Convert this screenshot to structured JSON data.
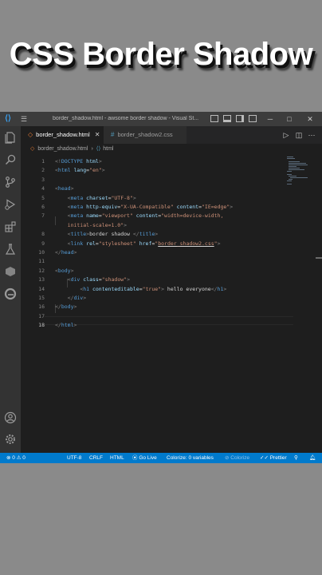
{
  "headline": "CSS Border Shadow",
  "window": {
    "title": "border_shadow.html - awsome border shadow - Visual St...",
    "controls": {
      "minimize": "─",
      "maximize": "□",
      "close": "✕"
    }
  },
  "tabs": [
    {
      "label": "border_shadow.html",
      "icon": "html-file-icon",
      "active": true,
      "close": "✕"
    },
    {
      "label": "border_shadow2.css",
      "icon": "css-file-icon",
      "active": false
    }
  ],
  "breadcrumb": {
    "file": "border_shadow.html",
    "separator": "›",
    "node": "html"
  },
  "editor": {
    "current_line": 18,
    "lines": [
      {
        "num": "1",
        "html": "<span class=\"g\">&lt;!</span><span class=\"t\">DOCTYPE</span> <span class=\"a\">html</span><span class=\"g\">&gt;</span>"
      },
      {
        "num": "2",
        "html": "<span class=\"g\">&lt;</span><span class=\"t\">html</span> <span class=\"a\">lang</span><span class=\"x\">=</span><span class=\"s\">\"en\"</span><span class=\"g\">&gt;</span>"
      },
      {
        "num": "3",
        "html": ""
      },
      {
        "num": "4",
        "html": "<span class=\"g\">&lt;</span><span class=\"t\">head</span><span class=\"g\">&gt;</span>"
      },
      {
        "num": "5",
        "html": "    <span class=\"g\">&lt;</span><span class=\"t\">meta</span> <span class=\"a\">charset</span><span class=\"x\">=</span><span class=\"s\">\"UTF-8\"</span><span class=\"g\">&gt;</span>"
      },
      {
        "num": "6",
        "html": "    <span class=\"g\">&lt;</span><span class=\"t\">meta</span> <span class=\"a\">http-equiv</span><span class=\"x\">=</span><span class=\"s\">\"X-UA-Compatible\"</span> <span class=\"a\">content</span><span class=\"x\">=</span><span class=\"s\">\"IE=edge\"</span><span class=\"g\">&gt;</span>"
      },
      {
        "num": "7",
        "html": "    <span class=\"g\">&lt;</span><span class=\"t\">meta</span> <span class=\"a\">name</span><span class=\"x\">=</span><span class=\"s\">\"viewport\"</span> <span class=\"a\">content</span><span class=\"x\">=</span><span class=\"s\">\"width=device-width,</span>"
      },
      {
        "num": "",
        "html": "    <span class=\"s\">initial-scale=1.0\"</span><span class=\"g\">&gt;</span>"
      },
      {
        "num": "8",
        "html": "    <span class=\"g\">&lt;</span><span class=\"t\">title</span><span class=\"g\">&gt;</span><span class=\"x\">border shadow </span><span class=\"g\">&lt;/</span><span class=\"t\">title</span><span class=\"g\">&gt;</span>"
      },
      {
        "num": "9",
        "html": "    <span class=\"g\">&lt;</span><span class=\"t\">link</span> <span class=\"a\">rel</span><span class=\"x\">=</span><span class=\"s\">\"stylesheet\"</span> <span class=\"a\">href</span><span class=\"x\">=</span><span class=\"s\">\"<span class=\"u\">border_shadow2.css</span>\"</span><span class=\"g\">&gt;</span>"
      },
      {
        "num": "10",
        "html": "<span class=\"g\">&lt;/</span><span class=\"t\">head</span><span class=\"g\">&gt;</span>"
      },
      {
        "num": "11",
        "html": ""
      },
      {
        "num": "12",
        "html": "<span class=\"g\">&lt;</span><span class=\"t\">body</span><span class=\"g\">&gt;</span>"
      },
      {
        "num": "13",
        "html": "    <span class=\"g\">&lt;</span><span class=\"t\">div</span> <span class=\"a\">class</span><span class=\"x\">=</span><span class=\"s\">\"shadow\"</span><span class=\"g\">&gt;</span>"
      },
      {
        "num": "14",
        "html": "        <span class=\"g\">&lt;</span><span class=\"t\">h1</span> <span class=\"a\">contenteditable</span><span class=\"x\">=</span><span class=\"s\">\"true\"</span><span class=\"g\">&gt;</span><span class=\"x\"> hello everyone</span><span class=\"g\">&lt;/</span><span class=\"t\">h1</span><span class=\"g\">&gt;</span>"
      },
      {
        "num": "15",
        "html": "    <span class=\"g\">&lt;/</span><span class=\"t\">div</span><span class=\"g\">&gt;</span>"
      },
      {
        "num": "16",
        "html": "<span class=\"g\">&lt;/</span><span class=\"t\">body</span><span class=\"g\">&gt;</span>"
      },
      {
        "num": "17",
        "html": ""
      },
      {
        "num": "18",
        "html": "<span class=\"g\">&lt;/</span><span class=\"t\">html</span><span class=\"g\">&gt;</span>"
      }
    ]
  },
  "statusbar": {
    "problems": "⊗ 0 ⚠ 0",
    "encoding": "UTF-8",
    "eol": "CRLF",
    "language": "HTML",
    "go_live": "Go Live",
    "colorize_vars": "Colorize: 0 variables",
    "colorize": "Colorize",
    "prettier": "Prettier"
  },
  "colors": {
    "background": "#8a8a8a",
    "titlebar": "#3c3c3c",
    "activitybar": "#333333",
    "editor": "#1e1e1e",
    "statusbar": "#007acc",
    "tag": "#569cd6",
    "attribute": "#9cdcfe",
    "string": "#ce9178"
  },
  "icons": {
    "activity": [
      "explorer-icon",
      "search-icon",
      "source-control-icon",
      "run-debug-icon",
      "extensions-icon",
      "testing-icon",
      "remote-explorer-icon",
      "edge-devtools-icon",
      "account-icon",
      "settings-gear-icon"
    ]
  }
}
